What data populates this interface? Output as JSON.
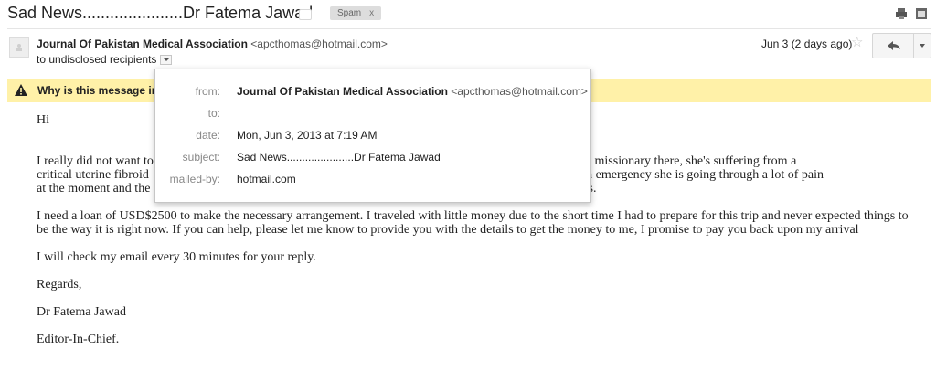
{
  "subject": {
    "title": "Sad News......................Dr Fatema Jawad",
    "label_chip": "Spam",
    "label_chip_close": "x"
  },
  "toolbar_icons": [
    "print-icon",
    "new-window-icon"
  ],
  "message": {
    "sender_name": "Journal Of Pakistan Medical Association",
    "sender_email": "<apcthomas@hotmail.com>",
    "recipients": "to undisclosed recipients",
    "date": "Jun 3 (2 days ago)"
  },
  "warning": {
    "text": "Why is this message in"
  },
  "details": {
    "from_label": "from:",
    "from_name": "Journal Of Pakistan Medical Association",
    "from_email": "<apcthomas@hotmail.com>",
    "to_label": "to:",
    "to_value": "",
    "date_label": "date:",
    "date_value": "Mon, Jun 3, 2013 at 7:19 AM",
    "subject_label": "subject:",
    "subject_value": "Sad News......................Dr Fatema Jawad",
    "mailedby_label": "mailed-by:",
    "mailedby_value": "hotmail.com"
  },
  "body": {
    "greeting": "Hi",
    "p1_line1": "I really did not want to                                                                                                          my cousin who is a missionary there, she's suffering from a",
    "p1_line2": "critical uterine fibroid                                                                                                              rrived to me as an emergency she is going through a lot of pain",
    "p1_line3": "at the moment and the d                                                                                                              y complications.",
    "p2": "I need a loan of USD$2500 to make the necessary arrangement. I traveled with little money due to the short time I had to prepare for this trip and never expected things to be the way it is right now. If you can help, please let me know to provide you with the details to get the money to me, I promise to pay you back upon my arrival",
    "p3": "I will check my email every 30 minutes for your reply.",
    "p4": "Regards,",
    "p5": "Dr Fatema Jawad",
    "p6": "Editor-In-Chief."
  },
  "colors": {
    "warning_bg": "#fff1a8",
    "chip_bg": "#dddddd",
    "divider": "#e5e5e5"
  }
}
